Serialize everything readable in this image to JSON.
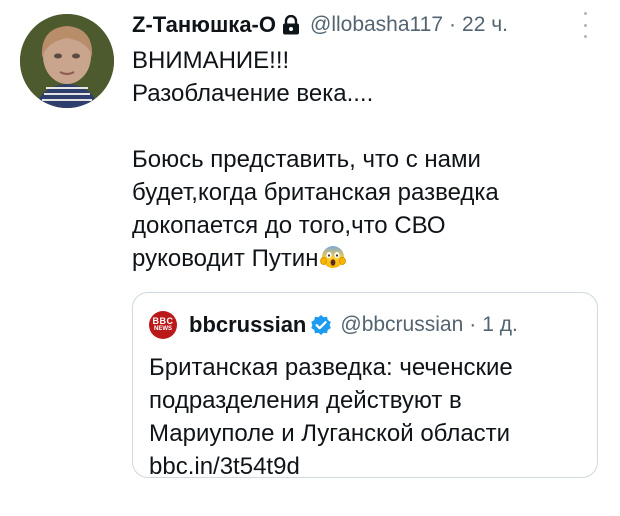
{
  "tweet": {
    "author_name": "Z-Танюшка-О",
    "handle": "@llobasha117",
    "separator": "·",
    "time": "22 ч.",
    "text_lines": [
      "ВНИМАНИЕ!!!",
      "Разоблачение века....",
      "",
      "Боюсь представить, что с нами",
      "будет,когда британская разведка",
      "докопается до того,что СВО",
      "руководит Путин"
    ],
    "emoji": "screaming-face-emoji"
  },
  "quote": {
    "author_name": "bbcrussian",
    "handle": "@bbcrussian",
    "separator": "·",
    "time": "1 д.",
    "avatar_text_top": "BBC",
    "avatar_text_bottom": "NEWS",
    "text_lines": [
      "Британская разведка: чеченские",
      "подразделения действуют в",
      "Мариуполе и Луганской области",
      "bbc.in/3t54t9d"
    ]
  },
  "colors": {
    "text": "#0f1419",
    "secondary": "#536471",
    "border": "#cfd9de",
    "verified": "#1d9bf0",
    "bbc_red": "#bb1919"
  }
}
